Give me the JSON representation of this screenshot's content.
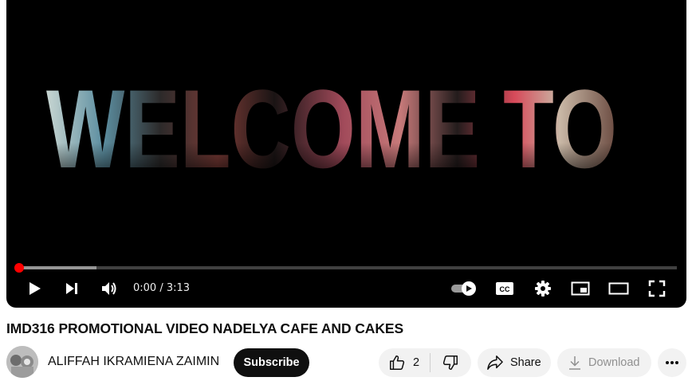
{
  "video": {
    "overlay_text": "WELCOME TO",
    "time_display": "0:00 / 3:13",
    "played_fraction": 0.0,
    "buffered_fraction": 0.12,
    "autoplay_on": true
  },
  "player_controls": {
    "play": "play-icon",
    "next": "next-icon",
    "volume": "volume-icon",
    "autoplay": "autoplay-toggle",
    "captions": "cc-icon",
    "settings": "gear-icon",
    "miniplayer": "miniplayer-icon",
    "theater": "theater-icon",
    "fullscreen": "fullscreen-icon"
  },
  "title": "IMD316 PROMOTIONAL VIDEO NADELYA CAFE AND CAKES",
  "channel": {
    "name": "ALIFFAH IKRAMIENA ZAIMIN",
    "subscribe_label": "Subscribe"
  },
  "actions": {
    "like_count": "2",
    "share_label": "Share",
    "download_label": "Download"
  },
  "colors": {
    "progress": "#ff0000",
    "subscribe_bg": "#0f0f0f",
    "pill_bg": "#f2f2f2",
    "disabled_text": "#909090"
  }
}
